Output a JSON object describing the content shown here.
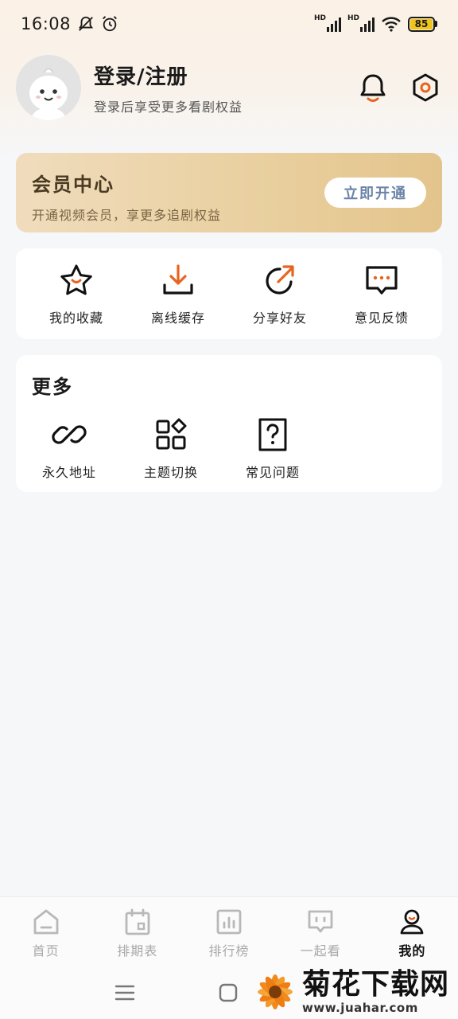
{
  "status_bar": {
    "time": "16:08",
    "network_label": "HD",
    "battery": "85"
  },
  "profile": {
    "title": "登录/注册",
    "subtitle": "登录后享受更多看剧权益"
  },
  "vip": {
    "title": "会员中心",
    "subtitle": "开通视频会员，享更多追剧权益",
    "button": "立即开通"
  },
  "quick_menu": [
    {
      "label": "我的收藏",
      "icon": "star-icon"
    },
    {
      "label": "离线缓存",
      "icon": "download-icon"
    },
    {
      "label": "分享好友",
      "icon": "share-icon"
    },
    {
      "label": "意见反馈",
      "icon": "feedback-icon"
    }
  ],
  "more": {
    "title": "更多",
    "items": [
      {
        "label": "永久地址",
        "icon": "link-icon"
      },
      {
        "label": "主题切换",
        "icon": "theme-icon"
      },
      {
        "label": "常见问题",
        "icon": "faq-icon"
      }
    ]
  },
  "bottom_nav": [
    {
      "label": "首页",
      "icon": "home-icon",
      "active": false
    },
    {
      "label": "排期表",
      "icon": "calendar-icon",
      "active": false
    },
    {
      "label": "排行榜",
      "icon": "ranking-icon",
      "active": false
    },
    {
      "label": "一起看",
      "icon": "watch-together-icon",
      "active": false
    },
    {
      "label": "我的",
      "icon": "profile-icon",
      "active": true
    }
  ],
  "watermark": {
    "cn": "菊花下载网",
    "en": "www.juahar.com"
  },
  "colors": {
    "accent": "#e8641e",
    "vip_gradient_start": "#f0dcbd",
    "vip_gradient_end": "#e3c48c",
    "battery": "#f0c419"
  }
}
